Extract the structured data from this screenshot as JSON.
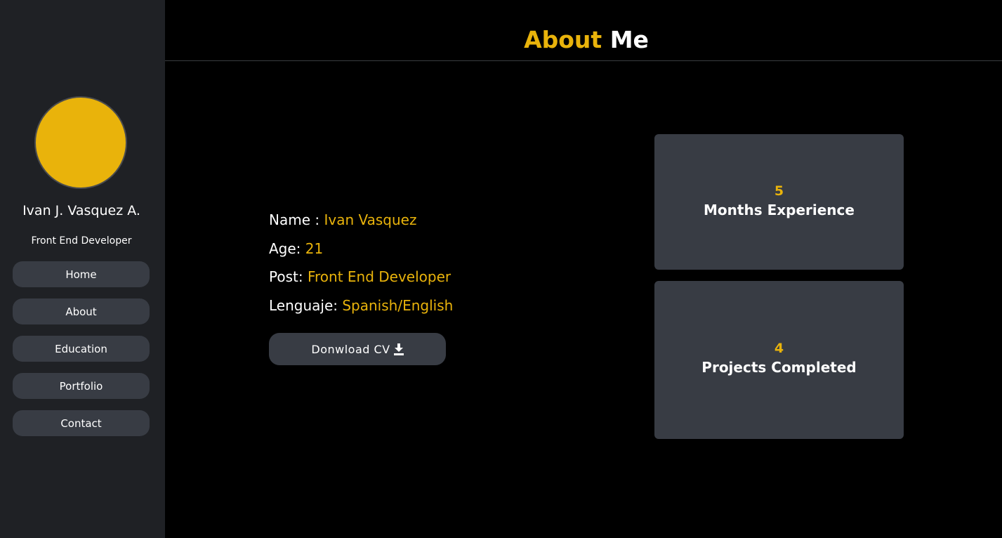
{
  "profile": {
    "name": "Ivan J. Vasquez A.",
    "role": "Front End Developer"
  },
  "nav": {
    "items": [
      "Home",
      "About",
      "Education",
      "Portfolio",
      "Contact"
    ]
  },
  "header": {
    "title_accent": "About",
    "title_rest": "Me"
  },
  "info": {
    "rows": [
      {
        "label": "Name : ",
        "value": "Ivan Vasquez"
      },
      {
        "label": "Age: ",
        "value": "21"
      },
      {
        "label": "Post: ",
        "value": "Front End Developer"
      },
      {
        "label": "Lenguaje: ",
        "value": "Spanish/English"
      }
    ],
    "cv_button_label": "Donwload CV"
  },
  "stats": [
    {
      "number": "5",
      "label": "Months Experience"
    },
    {
      "number": "4",
      "label": "Projects Completed"
    }
  ],
  "colors": {
    "accent": "#e9b30b",
    "sidebar_bg": "#1f2125",
    "card_bg": "#383c44",
    "page_bg": "#000000"
  },
  "icons": {
    "cv_button": "download-icon"
  }
}
